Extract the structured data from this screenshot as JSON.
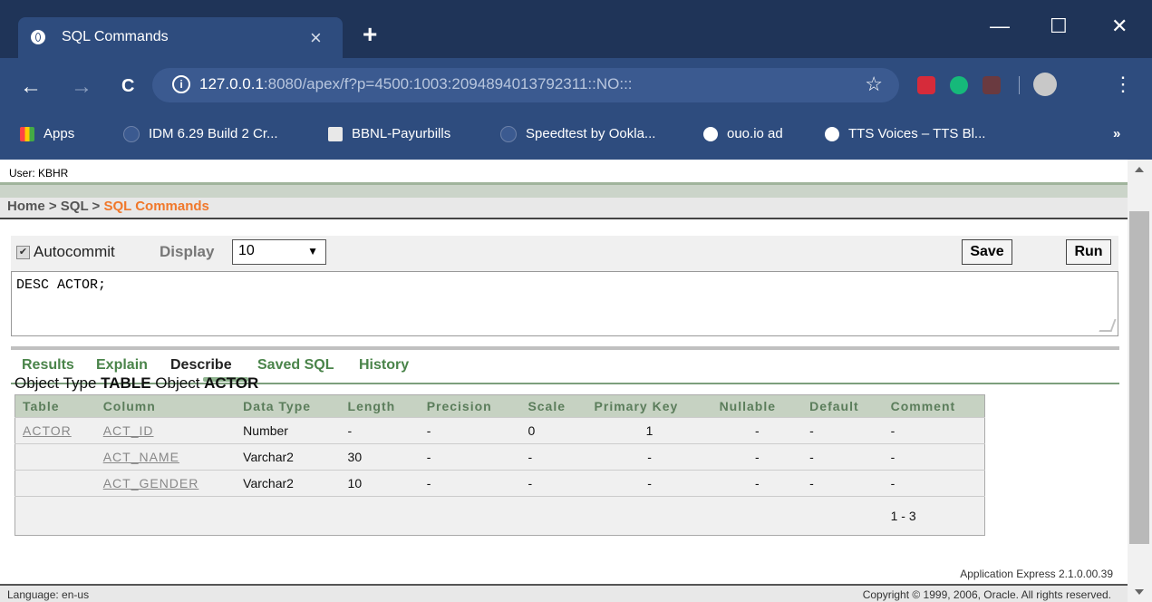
{
  "browser": {
    "tab_title": "SQL Commands",
    "tab_close": "×",
    "new_tab": "+",
    "url_host": "127.0.0.1",
    "url_rest": ":8080/apex/f?p=4500:1003:2094894013792311::NO:::",
    "info_glyph": "i",
    "window_buttons": {
      "minimize": "—",
      "maximize": "☐",
      "close": "✕"
    },
    "nav": {
      "back": "←",
      "forward": "→",
      "reload": "C",
      "star": "☆",
      "menu": "⋮"
    },
    "bookmarks": [
      {
        "label": "Apps",
        "icon": "apps-grid-icon"
      },
      {
        "label": "IDM 6.29 Build 2 Cr...",
        "icon": "page-icon"
      },
      {
        "label": "BBNL-Payurbills",
        "icon": "bbnl-icon"
      },
      {
        "label": "Speedtest by Ookla...",
        "icon": "page-icon"
      },
      {
        "label": "ouo.io ad",
        "icon": "globe-icon"
      },
      {
        "label": "TTS Voices – TTS Bl...",
        "icon": "globe-icon"
      }
    ],
    "bookmarks_more": "»"
  },
  "app": {
    "user_line": "User: KBHR",
    "breadcrumb": {
      "home": "Home",
      "sep": " > ",
      "sql": "SQL",
      "current": "SQL Commands"
    },
    "autocommit_label": "Autocommit",
    "autocommit_checked": true,
    "display_label": "Display",
    "display_value": "10",
    "save_label": "Save",
    "run_label": "Run",
    "sql_text": "DESC ACTOR;",
    "tabs": [
      "Results",
      "Explain",
      "Describe",
      "Saved SQL",
      "History"
    ],
    "active_tab": "Describe",
    "object": {
      "type_label": "Object Type",
      "type_value": "TABLE",
      "object_label": "Object",
      "object_value": "ACTOR"
    },
    "columns": [
      "Table",
      "Column",
      "Data Type",
      "Length",
      "Precision",
      "Scale",
      "Primary Key",
      "Nullable",
      "Default",
      "Comment"
    ],
    "rows": [
      [
        "ACTOR",
        "ACT_ID",
        "Number",
        "-",
        "-",
        "0",
        "1",
        "-",
        "-",
        "-"
      ],
      [
        "",
        "ACT_NAME",
        "Varchar2",
        "30",
        "-",
        "-",
        "-",
        "-",
        "-",
        "-"
      ],
      [
        "",
        "ACT_GENDER",
        "Varchar2",
        "10",
        "-",
        "-",
        "-",
        "-",
        "-",
        "-"
      ]
    ],
    "pagination": "1 - 3",
    "version": "Application Express 2.1.0.00.39",
    "language": "Language: en-us",
    "copyright": "Copyright © 1999, 2006, Oracle. All rights reserved."
  }
}
